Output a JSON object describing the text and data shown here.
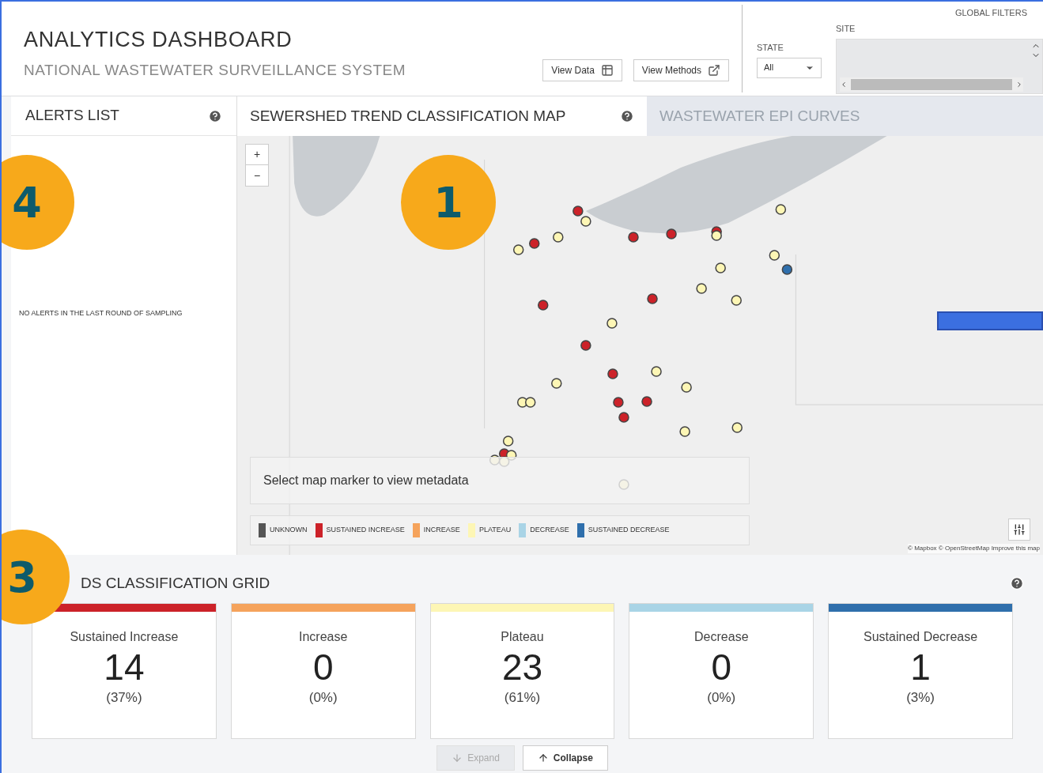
{
  "header": {
    "title": "ANALYTICS DASHBOARD",
    "subtitle": "NATIONAL WASTEWATER SURVEILLANCE SYSTEM",
    "buttons": [
      {
        "label": "View Data",
        "kind": "table"
      },
      {
        "label": "View Methods",
        "kind": "external"
      }
    ]
  },
  "filters": {
    "title": "GLOBAL FILTERS",
    "state": {
      "label": "STATE",
      "value": "All"
    },
    "site": {
      "label": "SITE"
    }
  },
  "alerts": {
    "title": "ALERTS LIST",
    "message": "NO ALERTS IN THE LAST ROUND OF SAMPLING"
  },
  "tabs": [
    {
      "label": "SEWERSHED TREND CLASSIFICATION MAP",
      "selected": true
    },
    {
      "label": "WASTEWATER EPI CURVES",
      "selected": false
    }
  ],
  "map": {
    "zoom_in": "+",
    "zoom_out": "−",
    "info": "Select map marker to view metadata",
    "attribution": "© Mapbox © OpenStreetMap Improve this map",
    "legend": [
      {
        "label": "UNKNOWN",
        "color": "#555555"
      },
      {
        "label": "SUSTAINED INCREASE",
        "color": "#cc2229"
      },
      {
        "label": "INCREASE",
        "color": "#f5a35c"
      },
      {
        "label": "PLATEAU",
        "color": "#fdf6b5"
      },
      {
        "label": "DECREASE",
        "color": "#a9d4e6"
      },
      {
        "label": "SUSTAINED DECREASE",
        "color": "#2f6fac"
      }
    ]
  },
  "grid": {
    "title": "DS CLASSIFICATION GRID",
    "cards": [
      {
        "label": "Sustained Increase",
        "count": "14",
        "percent": "(37%)",
        "color": "#cc2229"
      },
      {
        "label": "Increase",
        "count": "0",
        "percent": "(0%)",
        "color": "#f5a35c"
      },
      {
        "label": "Plateau",
        "count": "23",
        "percent": "(61%)",
        "color": "#fdf6b5"
      },
      {
        "label": "Decrease",
        "count": "0",
        "percent": "(0%)",
        "color": "#a9d4e6"
      },
      {
        "label": "Sustained Decrease",
        "count": "1",
        "percent": "(3%)",
        "color": "#2f6fac"
      }
    ],
    "expand": {
      "label": "Expand",
      "disabled": true
    },
    "collapse": {
      "label": "Collapse",
      "disabled": false
    }
  },
  "callouts": [
    "4",
    "1",
    "3"
  ]
}
